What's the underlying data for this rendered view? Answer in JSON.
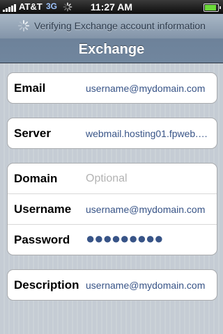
{
  "status_bar": {
    "carrier": "AT&T",
    "network": "3G",
    "time": "11:27 AM",
    "signal_bars": 5,
    "battery_level": 0.95,
    "activity_icon": "spinner-icon"
  },
  "navigation": {
    "prompt": "Verifying Exchange account information",
    "prompt_icon": "spinner-icon",
    "title": "Exchange"
  },
  "groups": [
    {
      "rows": [
        {
          "label": "Email",
          "value": "username@mydomain.com"
        }
      ]
    },
    {
      "rows": [
        {
          "label": "Server",
          "value": "webmail.hosting01.fpweb.…"
        }
      ]
    },
    {
      "rows": [
        {
          "label": "Domain",
          "placeholder": "Optional"
        },
        {
          "label": "Username",
          "value": "username@mydomain.com"
        },
        {
          "label": "Password",
          "value": "●●●●●●●●●"
        }
      ]
    },
    {
      "rows": [
        {
          "label": "Description",
          "value": "username@mydomain.com"
        }
      ]
    }
  ],
  "colors": {
    "value_text": "#385487",
    "placeholder_text": "#b3b3b3",
    "background": "#c5ccd4"
  }
}
